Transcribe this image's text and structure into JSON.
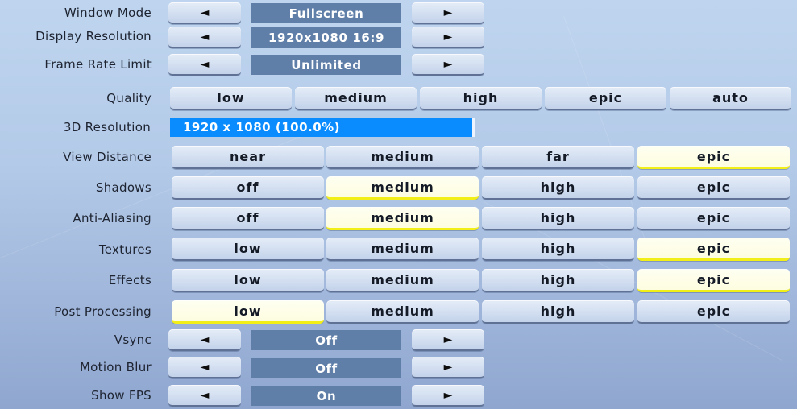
{
  "selector_rows": [
    {
      "label": "Window Mode",
      "value": "Fullscreen"
    },
    {
      "label": "Display Resolution",
      "value": "1920x1080 16:9"
    },
    {
      "label": "Frame Rate Limit",
      "value": "Unlimited"
    }
  ],
  "quality": {
    "label": "Quality",
    "options": [
      "low",
      "medium",
      "high",
      "epic",
      "auto"
    ]
  },
  "resolution_3d": {
    "label": "3D Resolution",
    "value_text": "1920 x 1080 (100.0%)",
    "percent": 100.0
  },
  "option_rows": [
    {
      "label": "View Distance",
      "options": [
        "near",
        "medium",
        "far",
        "epic"
      ],
      "selected": "epic"
    },
    {
      "label": "Shadows",
      "options": [
        "off",
        "medium",
        "high",
        "epic"
      ],
      "selected": "medium"
    },
    {
      "label": "Anti-Aliasing",
      "options": [
        "off",
        "medium",
        "high",
        "epic"
      ],
      "selected": "medium"
    },
    {
      "label": "Textures",
      "options": [
        "low",
        "medium",
        "high",
        "epic"
      ],
      "selected": "epic"
    },
    {
      "label": "Effects",
      "options": [
        "low",
        "medium",
        "high",
        "epic"
      ],
      "selected": "epic"
    },
    {
      "label": "Post Processing",
      "options": [
        "low",
        "medium",
        "high",
        "epic"
      ],
      "selected": "low"
    }
  ],
  "toggle_rows": [
    {
      "label": "Vsync",
      "value": "Off"
    },
    {
      "label": "Motion Blur",
      "value": "Off"
    },
    {
      "label": "Show FPS",
      "value": "On"
    }
  ],
  "icons": {
    "prev": "◄",
    "next": "►"
  },
  "colors": {
    "selected_accent": "#f2ee18",
    "value_box": "#5f7ea8",
    "resolution_bar": "#0a8cfe"
  }
}
